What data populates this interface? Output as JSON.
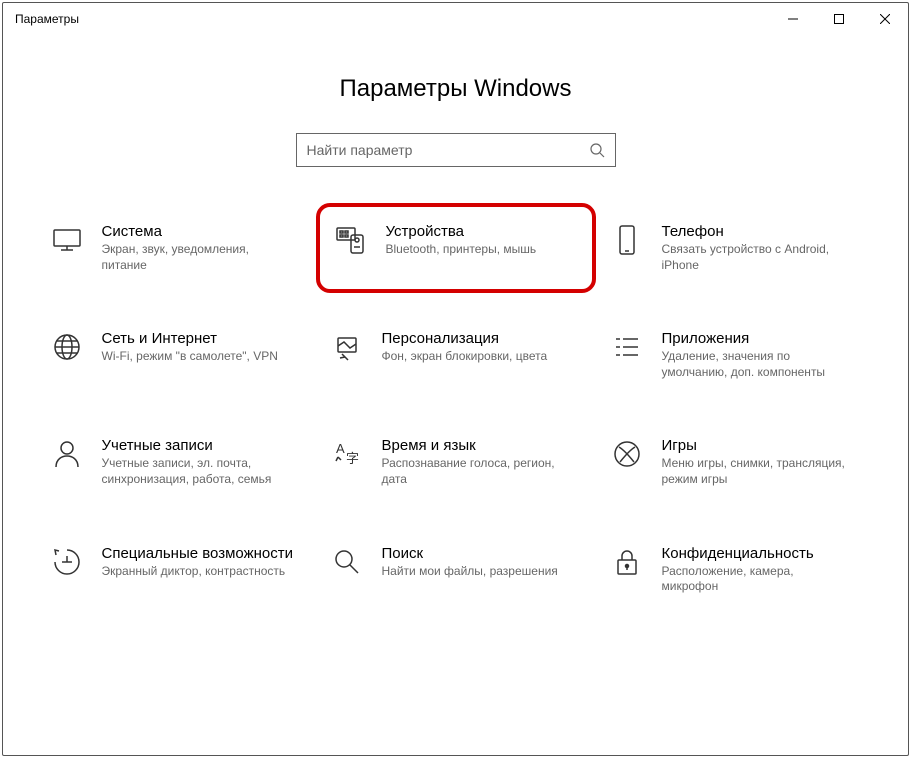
{
  "titlebar": {
    "title": "Параметры"
  },
  "header": {
    "page_title": "Параметры Windows"
  },
  "search": {
    "placeholder": "Найти параметр"
  },
  "tiles": [
    {
      "label": "Система",
      "desc": "Экран, звук, уведомления, питание"
    },
    {
      "label": "Устройства",
      "desc": "Bluetooth, принтеры, мышь"
    },
    {
      "label": "Телефон",
      "desc": "Связать устройство с Android, iPhone"
    },
    {
      "label": "Сеть и Интернет",
      "desc": "Wi-Fi, режим \"в самолете\", VPN"
    },
    {
      "label": "Персонализация",
      "desc": "Фон, экран блокировки, цвета"
    },
    {
      "label": "Приложения",
      "desc": "Удаление, значения по умолчанию, доп. компоненты"
    },
    {
      "label": "Учетные записи",
      "desc": "Учетные записи, эл. почта, синхронизация, работа, семья"
    },
    {
      "label": "Время и язык",
      "desc": "Распознавание голоса, регион, дата"
    },
    {
      "label": "Игры",
      "desc": "Меню игры, снимки, трансляция, режим игры"
    },
    {
      "label": "Специальные возможности",
      "desc": "Экранный диктор, контрастность"
    },
    {
      "label": "Поиск",
      "desc": "Найти мои файлы, разрешения"
    },
    {
      "label": "Конфиденциальность",
      "desc": "Расположение, камера, микрофон"
    }
  ]
}
